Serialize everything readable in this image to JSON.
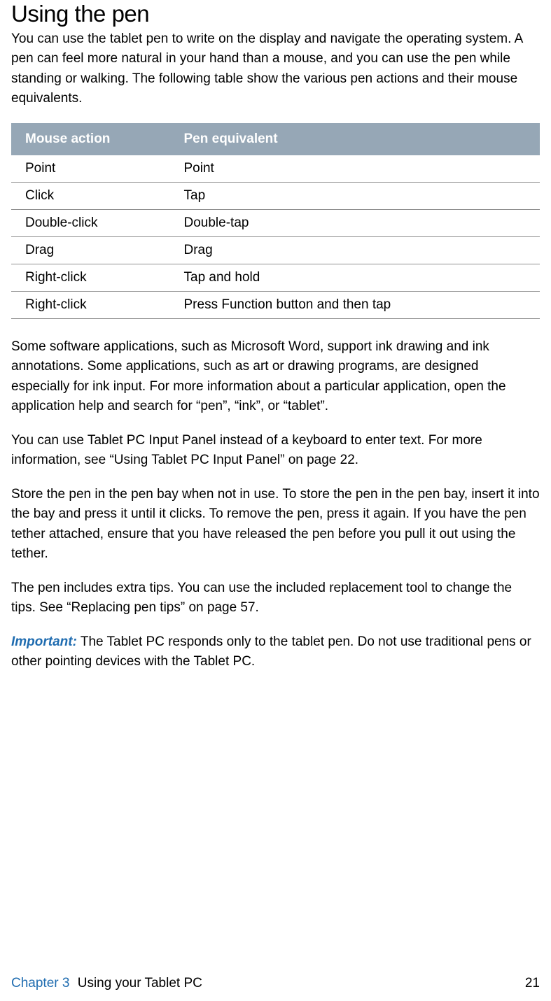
{
  "heading": "Using the pen",
  "intro": "You can use the tablet pen to write on the display and navigate the operating system. A pen can feel more natural in your hand than a mouse, and you can use the pen while standing or walking. The following table show the various pen actions and their mouse equivalents.",
  "table": {
    "headers": {
      "mouse": "Mouse action",
      "pen": "Pen equivalent"
    },
    "rows": [
      {
        "mouse": "Point",
        "pen": "Point"
      },
      {
        "mouse": "Click",
        "pen": "Tap"
      },
      {
        "mouse": "Double-click",
        "pen": "Double-tap"
      },
      {
        "mouse": "Drag",
        "pen": "Drag"
      },
      {
        "mouse": "Right-click",
        "pen": "Tap and hold"
      },
      {
        "mouse": "Right-click",
        "pen": "Press Function button and then tap"
      }
    ]
  },
  "para_ink": "Some software applications, such as Microsoft Word, support ink drawing and ink annotations. Some applications, such as art or drawing programs, are designed especially for ink input. For more information about a particular application, open the application help and search for “pen”, “ink”, or “tablet”.",
  "para_inputpanel": "You can use Tablet PC Input Panel instead of a keyboard to enter text. For more information, see “Using Tablet PC Input Panel” on page 22.",
  "para_store": "Store the pen in the pen bay when not in use. To store the pen in the pen bay, insert it into the bay and press it until it clicks. To remove the pen, press it again. If you have the pen tether attached, ensure that you have released the pen before you pull it out using the tether.",
  "para_tips": "The pen includes extra tips. You can use the included replacement tool to change the tips. See “Replacing pen tips” on page 57.",
  "important": {
    "label": "Important:",
    "text": " The Tablet PC responds only to the tablet pen. Do not use traditional pens or other pointing devices with the Tablet PC."
  },
  "footer": {
    "chapter": "Chapter 3",
    "title": "Using your Tablet PC",
    "pagenum": "21"
  }
}
